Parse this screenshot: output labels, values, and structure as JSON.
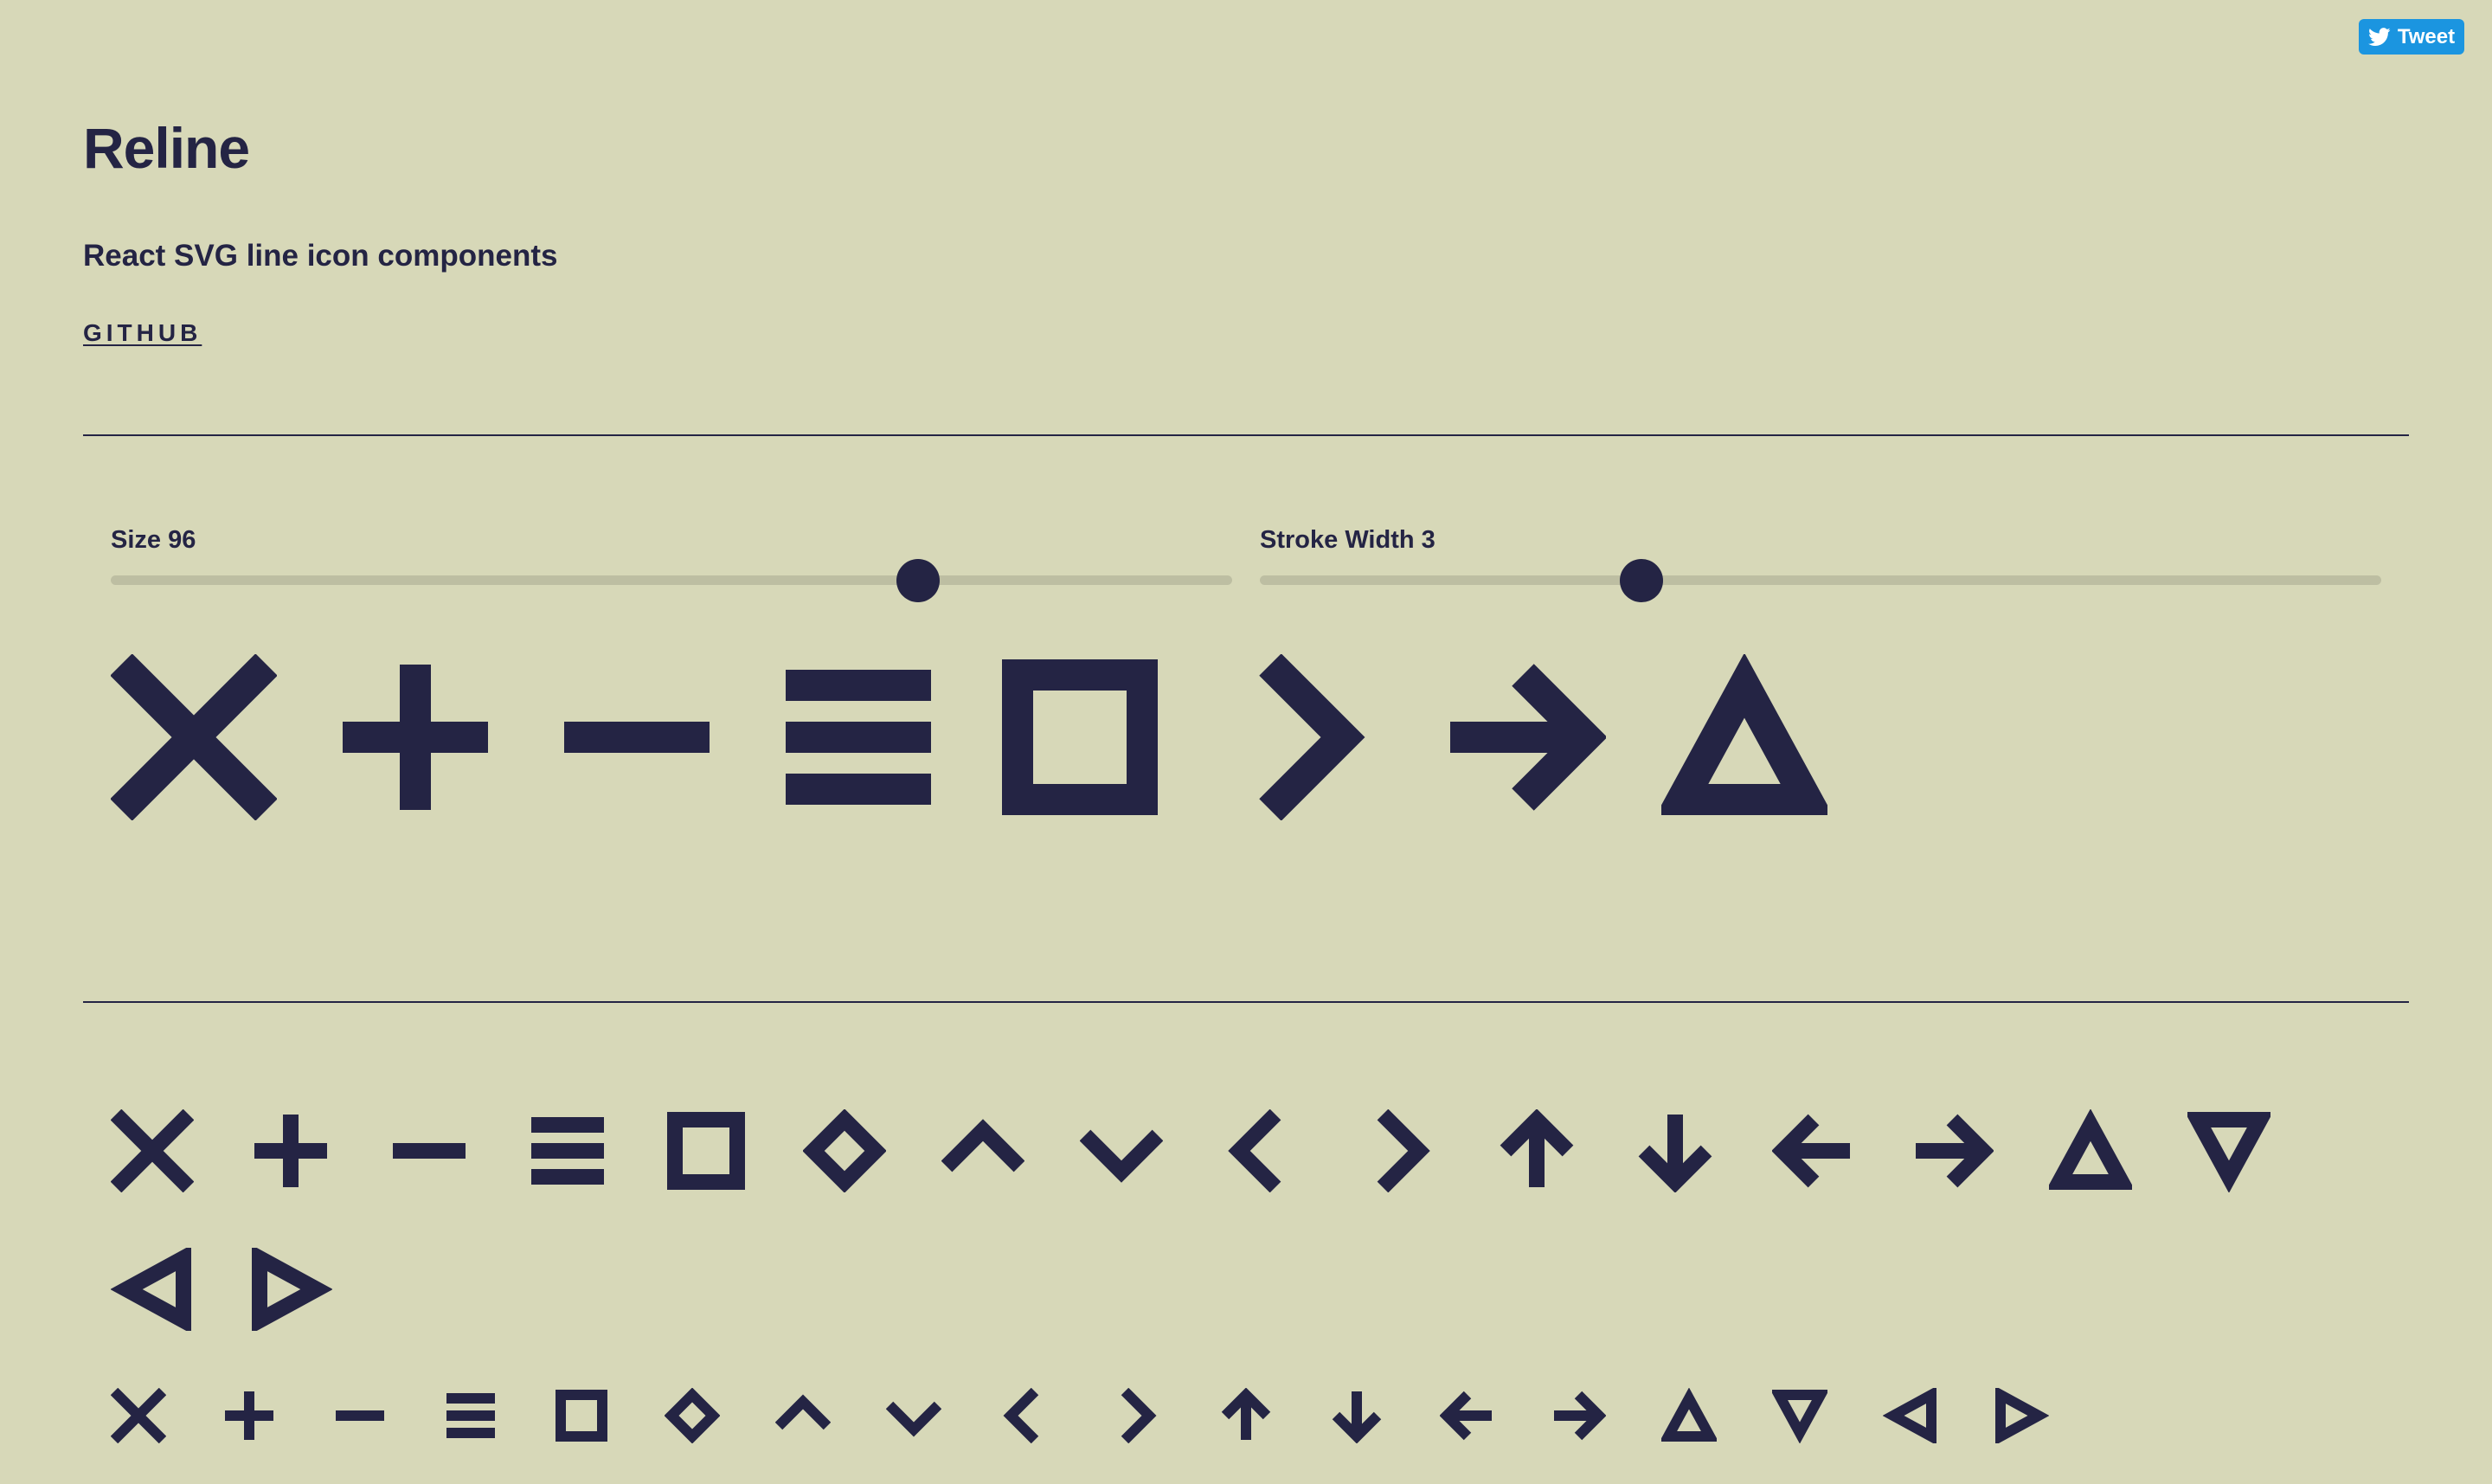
{
  "header": {
    "tweet_label": "Tweet",
    "tweet_icon": "twitter-bird-icon",
    "title": "Reline",
    "subtitle": "React SVG line icon components",
    "github_label": "GITHUB"
  },
  "controls": {
    "size_label": "Size 96",
    "size_value": 96,
    "size_fraction": 0.72,
    "stroke_label": "Stroke Width 3",
    "stroke_value": 3,
    "stroke_fraction": 0.34
  },
  "preview_icons": [
    "x",
    "plus",
    "minus",
    "hamburger",
    "square",
    "chevron-right",
    "arrow-right",
    "triangle-up"
  ],
  "all_icons": [
    "x",
    "plus",
    "minus",
    "hamburger",
    "square",
    "diamond",
    "chevron-up",
    "chevron-down",
    "chevron-left",
    "chevron-right",
    "arrow-up",
    "arrow-down",
    "arrow-left",
    "arrow-right",
    "triangle-up",
    "triangle-down",
    "triangle-left",
    "triangle-right"
  ],
  "colors": {
    "background": "#d7d8b8",
    "foreground": "#242444",
    "track": "#bdbea2",
    "tweet": "#1b95e0"
  }
}
